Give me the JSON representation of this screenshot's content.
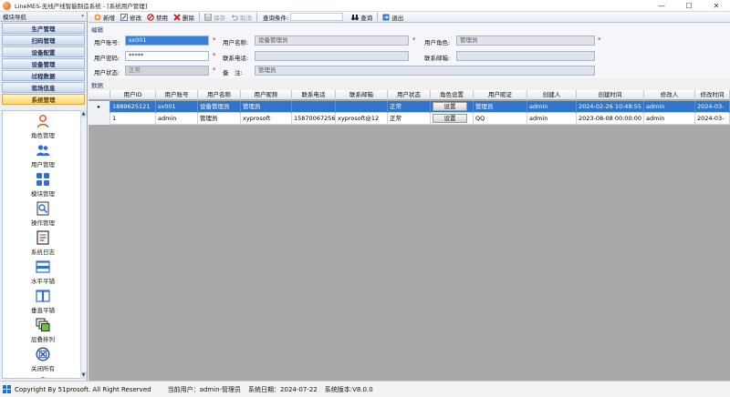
{
  "window": {
    "title": "LineMES-无线产线智能制造系统 - [系统用户管理]",
    "controls": {
      "minimize": "—",
      "maximize": "☐",
      "close": "✕"
    }
  },
  "sidebar": {
    "header": "模块导航",
    "pin": "ᵠ",
    "modules": [
      {
        "label": "生产管理",
        "active": false
      },
      {
        "label": "扫码管理",
        "active": false
      },
      {
        "label": "设备配置",
        "active": false
      },
      {
        "label": "设备管理",
        "active": false
      },
      {
        "label": "过程数据",
        "active": false
      },
      {
        "label": "现场信息",
        "active": false
      },
      {
        "label": "系统管理",
        "active": true
      }
    ],
    "functions": [
      {
        "label": "角色管理",
        "icon": "role-icon"
      },
      {
        "label": "用户管理",
        "icon": "user-icon"
      },
      {
        "label": "模块管理",
        "icon": "module-icon"
      },
      {
        "label": "操作管理",
        "icon": "operation-icon"
      },
      {
        "label": "系统日志",
        "icon": "log-icon"
      },
      {
        "label": "水平平铺",
        "icon": "tile-horizontal-icon"
      },
      {
        "label": "垂直平铺",
        "icon": "tile-vertical-icon"
      },
      {
        "label": "层叠排列",
        "icon": "cascade-icon"
      },
      {
        "label": "关闭所有",
        "icon": "close-all-icon"
      },
      {
        "label": "锁定",
        "icon": "lock-icon"
      }
    ],
    "scroll_up": "▲",
    "scroll_down": "▼"
  },
  "toolbar": {
    "new": "新增",
    "edit": "修改",
    "disable": "禁用",
    "delete": "删除",
    "save": "保存",
    "cancel": "取消",
    "search_label": "查询条件:",
    "query": "查询",
    "exit": "退出"
  },
  "form": {
    "section_title": "编辑",
    "user_no_label": "用户账号:",
    "user_no_value": "sx001",
    "user_name_label": "用户名称:",
    "user_name_value": "设备管理员",
    "role_label": "用户角色:",
    "role_value": "管理员",
    "password_label": "用户密码:",
    "password_value": "*****",
    "phone_label": "联系电话:",
    "phone_value": "",
    "email_label": "联系邮箱:",
    "email_value": "",
    "status_label": "用户状态:",
    "status_value": "正常",
    "remark_label": "备　注:",
    "remark_value": "管理员",
    "required_mark": "*"
  },
  "grid": {
    "title": "数据",
    "columns": [
      "",
      "用户ID",
      "用户账号",
      "用户名称",
      "用户昵称",
      "联系电话",
      "联系邮箱",
      "用户状态",
      "角色设置",
      "用户昵证",
      "创建人",
      "创建时间",
      "修改人",
      "修改时间"
    ],
    "rows": [
      {
        "selected": true,
        "marker": "▸",
        "cells": [
          "1889625121",
          "sx001",
          "设备管理员",
          "管理员",
          "",
          "",
          "正常",
          "设置",
          "管理员",
          "admin",
          "2024-02-26 10:48:55",
          "admin",
          "2024-03-"
        ]
      },
      {
        "selected": false,
        "marker": "",
        "cells": [
          "1",
          "admin",
          "管理员",
          "xyprosoft",
          "15870067256",
          "xyprosoft@12",
          "正常",
          "设置",
          "QQ",
          "admin",
          "2023-08-08 00:00:00",
          "admin",
          "2024-03-"
        ]
      }
    ]
  },
  "statusbar": {
    "copyright": "Copyright By 51prosoft. All Right Reserved",
    "current_user": "当前用户：admin-管理员",
    "system_date": "系统日期：2024-07-22",
    "version": "系统版本:V8.0.0"
  },
  "colors": {
    "accent": "#2f75cc",
    "active_module": "#ffd56b",
    "required": "#d01010"
  }
}
